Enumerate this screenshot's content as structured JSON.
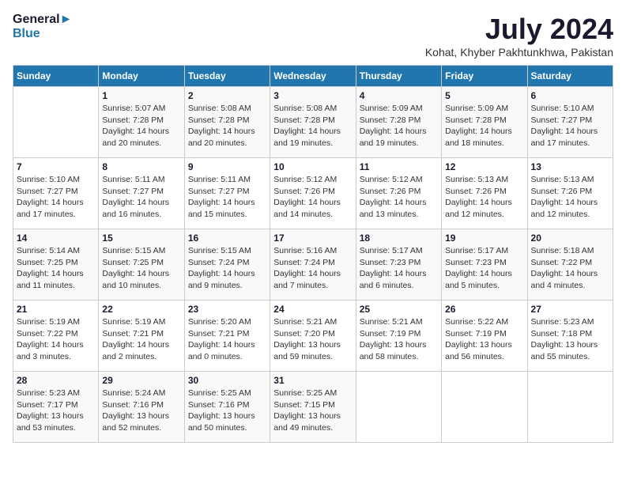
{
  "header": {
    "logo_line1": "General",
    "logo_line2": "Blue",
    "title": "July 2024",
    "subtitle": "Kohat, Khyber Pakhtunkhwa, Pakistan"
  },
  "days_of_week": [
    "Sunday",
    "Monday",
    "Tuesday",
    "Wednesday",
    "Thursday",
    "Friday",
    "Saturday"
  ],
  "weeks": [
    [
      {
        "day": "",
        "info": ""
      },
      {
        "day": "1",
        "info": "Sunrise: 5:07 AM\nSunset: 7:28 PM\nDaylight: 14 hours\nand 20 minutes."
      },
      {
        "day": "2",
        "info": "Sunrise: 5:08 AM\nSunset: 7:28 PM\nDaylight: 14 hours\nand 20 minutes."
      },
      {
        "day": "3",
        "info": "Sunrise: 5:08 AM\nSunset: 7:28 PM\nDaylight: 14 hours\nand 19 minutes."
      },
      {
        "day": "4",
        "info": "Sunrise: 5:09 AM\nSunset: 7:28 PM\nDaylight: 14 hours\nand 19 minutes."
      },
      {
        "day": "5",
        "info": "Sunrise: 5:09 AM\nSunset: 7:28 PM\nDaylight: 14 hours\nand 18 minutes."
      },
      {
        "day": "6",
        "info": "Sunrise: 5:10 AM\nSunset: 7:27 PM\nDaylight: 14 hours\nand 17 minutes."
      }
    ],
    [
      {
        "day": "7",
        "info": "Sunrise: 5:10 AM\nSunset: 7:27 PM\nDaylight: 14 hours\nand 17 minutes."
      },
      {
        "day": "8",
        "info": "Sunrise: 5:11 AM\nSunset: 7:27 PM\nDaylight: 14 hours\nand 16 minutes."
      },
      {
        "day": "9",
        "info": "Sunrise: 5:11 AM\nSunset: 7:27 PM\nDaylight: 14 hours\nand 15 minutes."
      },
      {
        "day": "10",
        "info": "Sunrise: 5:12 AM\nSunset: 7:26 PM\nDaylight: 14 hours\nand 14 minutes."
      },
      {
        "day": "11",
        "info": "Sunrise: 5:12 AM\nSunset: 7:26 PM\nDaylight: 14 hours\nand 13 minutes."
      },
      {
        "day": "12",
        "info": "Sunrise: 5:13 AM\nSunset: 7:26 PM\nDaylight: 14 hours\nand 12 minutes."
      },
      {
        "day": "13",
        "info": "Sunrise: 5:13 AM\nSunset: 7:26 PM\nDaylight: 14 hours\nand 12 minutes."
      }
    ],
    [
      {
        "day": "14",
        "info": "Sunrise: 5:14 AM\nSunset: 7:25 PM\nDaylight: 14 hours\nand 11 minutes."
      },
      {
        "day": "15",
        "info": "Sunrise: 5:15 AM\nSunset: 7:25 PM\nDaylight: 14 hours\nand 10 minutes."
      },
      {
        "day": "16",
        "info": "Sunrise: 5:15 AM\nSunset: 7:24 PM\nDaylight: 14 hours\nand 9 minutes."
      },
      {
        "day": "17",
        "info": "Sunrise: 5:16 AM\nSunset: 7:24 PM\nDaylight: 14 hours\nand 7 minutes."
      },
      {
        "day": "18",
        "info": "Sunrise: 5:17 AM\nSunset: 7:23 PM\nDaylight: 14 hours\nand 6 minutes."
      },
      {
        "day": "19",
        "info": "Sunrise: 5:17 AM\nSunset: 7:23 PM\nDaylight: 14 hours\nand 5 minutes."
      },
      {
        "day": "20",
        "info": "Sunrise: 5:18 AM\nSunset: 7:22 PM\nDaylight: 14 hours\nand 4 minutes."
      }
    ],
    [
      {
        "day": "21",
        "info": "Sunrise: 5:19 AM\nSunset: 7:22 PM\nDaylight: 14 hours\nand 3 minutes."
      },
      {
        "day": "22",
        "info": "Sunrise: 5:19 AM\nSunset: 7:21 PM\nDaylight: 14 hours\nand 2 minutes."
      },
      {
        "day": "23",
        "info": "Sunrise: 5:20 AM\nSunset: 7:21 PM\nDaylight: 14 hours\nand 0 minutes."
      },
      {
        "day": "24",
        "info": "Sunrise: 5:21 AM\nSunset: 7:20 PM\nDaylight: 13 hours\nand 59 minutes."
      },
      {
        "day": "25",
        "info": "Sunrise: 5:21 AM\nSunset: 7:19 PM\nDaylight: 13 hours\nand 58 minutes."
      },
      {
        "day": "26",
        "info": "Sunrise: 5:22 AM\nSunset: 7:19 PM\nDaylight: 13 hours\nand 56 minutes."
      },
      {
        "day": "27",
        "info": "Sunrise: 5:23 AM\nSunset: 7:18 PM\nDaylight: 13 hours\nand 55 minutes."
      }
    ],
    [
      {
        "day": "28",
        "info": "Sunrise: 5:23 AM\nSunset: 7:17 PM\nDaylight: 13 hours\nand 53 minutes."
      },
      {
        "day": "29",
        "info": "Sunrise: 5:24 AM\nSunset: 7:16 PM\nDaylight: 13 hours\nand 52 minutes."
      },
      {
        "day": "30",
        "info": "Sunrise: 5:25 AM\nSunset: 7:16 PM\nDaylight: 13 hours\nand 50 minutes."
      },
      {
        "day": "31",
        "info": "Sunrise: 5:25 AM\nSunset: 7:15 PM\nDaylight: 13 hours\nand 49 minutes."
      },
      {
        "day": "",
        "info": ""
      },
      {
        "day": "",
        "info": ""
      },
      {
        "day": "",
        "info": ""
      }
    ]
  ]
}
